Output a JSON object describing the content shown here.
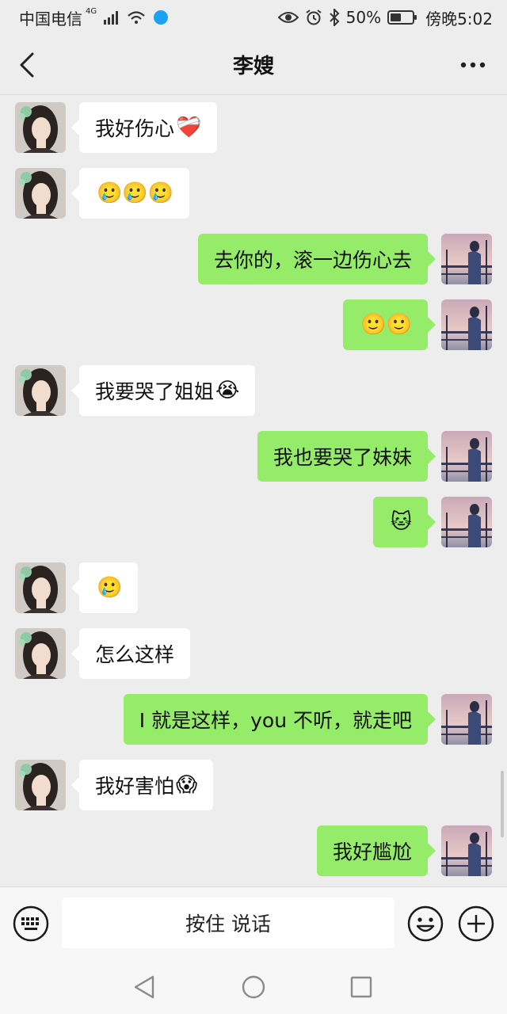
{
  "status_bar": {
    "carrier": "中国电信",
    "network_badge": "4G",
    "battery_percent": "50%",
    "battery_level": 0.5,
    "time": "傍晚5:02"
  },
  "header": {
    "title": "李嫂"
  },
  "messages": [
    {
      "side": "left",
      "text": "我好伤心",
      "emoji": "❤️‍🩹"
    },
    {
      "side": "left",
      "text": "",
      "emoji": "🥲🥲🥲"
    },
    {
      "side": "right",
      "text": "去你的，滚一边伤心去",
      "emoji": ""
    },
    {
      "side": "right",
      "text": "",
      "emoji": "🙂🙂"
    },
    {
      "side": "left",
      "text": "我要哭了姐姐",
      "emoji": "😭"
    },
    {
      "side": "right",
      "text": "我也要哭了妹妹",
      "emoji": ""
    },
    {
      "side": "right",
      "text": "",
      "emoji": "🐱"
    },
    {
      "side": "left",
      "text": "",
      "emoji": "🥲"
    },
    {
      "side": "left",
      "text": "怎么这样",
      "emoji": ""
    },
    {
      "side": "right",
      "text": "I 就是这样，you 不听，就走吧",
      "emoji": ""
    },
    {
      "side": "left",
      "text": "我好害怕",
      "emoji": "😱"
    },
    {
      "side": "right",
      "text": "我好尴尬",
      "emoji": ""
    }
  ],
  "input_bar": {
    "voice_label": "按住 说话"
  },
  "colors": {
    "self_bubble": "#95ec69",
    "other_bubble": "#ffffff",
    "background": "#ededed"
  }
}
